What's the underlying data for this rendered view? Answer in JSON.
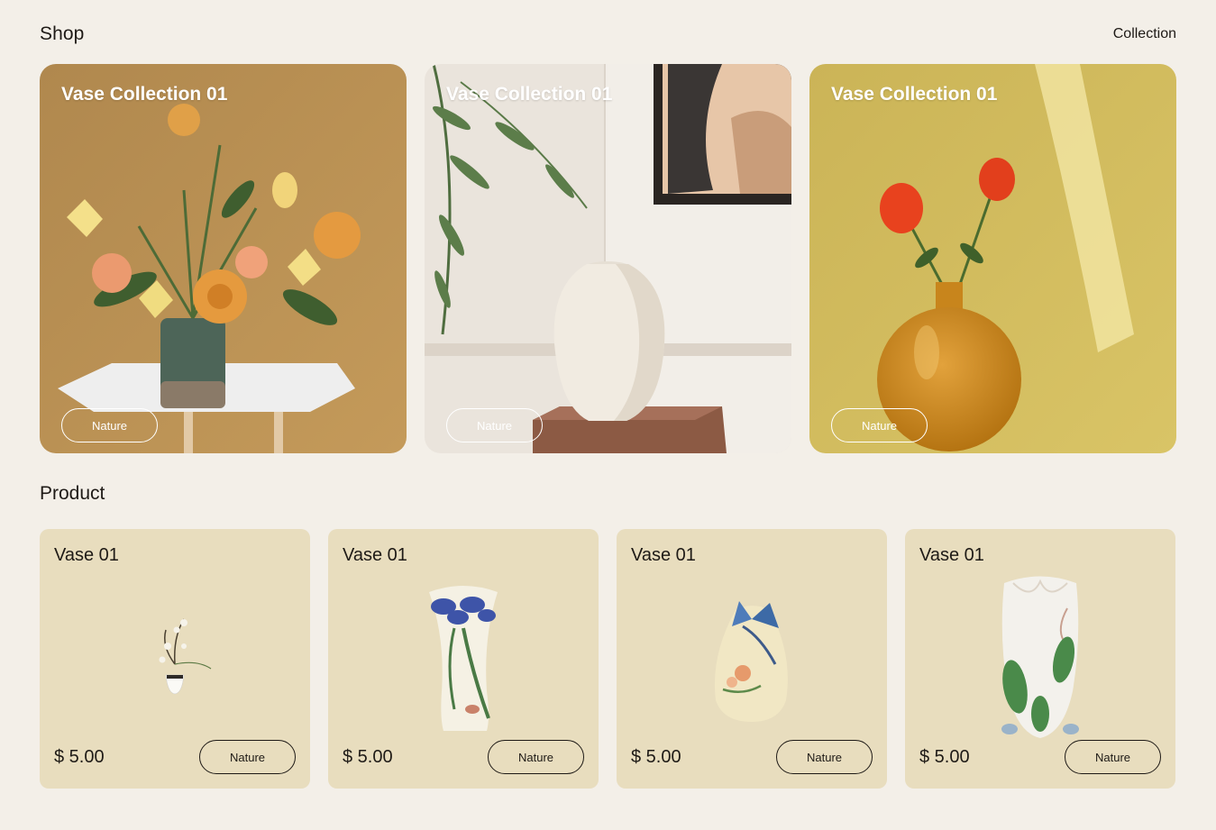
{
  "header": {
    "title": "Shop",
    "collection_link": "Collection"
  },
  "collections": [
    {
      "title": "Vase Collection 01",
      "tag": "Nature",
      "image": "orange-flowers-vase-photo"
    },
    {
      "title": "Vase Collection 01",
      "tag": "Nature",
      "image": "white-vase-photo"
    },
    {
      "title": "Vase Collection 01",
      "tag": "Nature",
      "image": "amber-glass-vase-roses-photo"
    }
  ],
  "products_section": {
    "title": "Product"
  },
  "products": [
    {
      "name": "Vase 01",
      "price": "$ 5.00",
      "tag": "Nature",
      "image": "ikebana-pot"
    },
    {
      "name": "Vase 01",
      "price": "$ 5.00",
      "tag": "Nature",
      "image": "iris-porcelain-vase"
    },
    {
      "name": "Vase 01",
      "price": "$ 5.00",
      "tag": "Nature",
      "image": "butterfly-porcelain-vase"
    },
    {
      "name": "Vase 01",
      "price": "$ 5.00",
      "tag": "Nature",
      "image": "lily-porcelain-vase"
    }
  ],
  "colors": {
    "background": "#f3efe8",
    "product_card": "#e8ddbe",
    "text": "#1e1a16"
  }
}
